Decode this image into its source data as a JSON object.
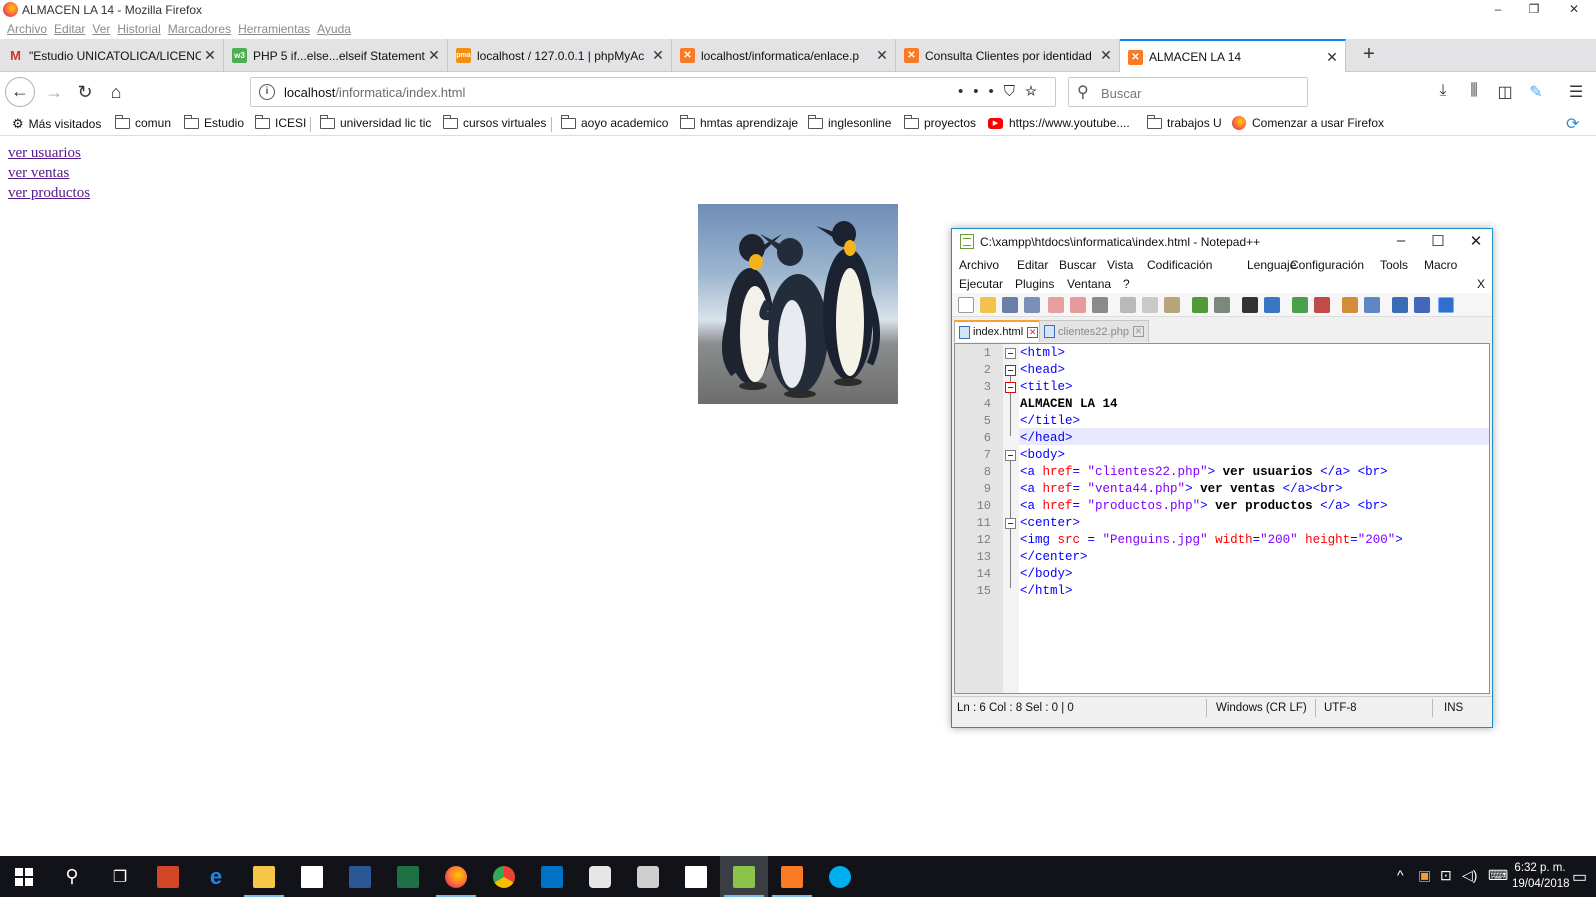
{
  "window": {
    "title": "ALMACEN LA 14 - Mozilla Firefox",
    "controls": [
      "–",
      "❐",
      "✕"
    ]
  },
  "menubar": [
    "Archivo",
    "Editar",
    "Ver",
    "Historial",
    "Marcadores",
    "Herramientas",
    "Ayuda"
  ],
  "tabs": [
    {
      "label": "\"Estudio UNICATOLICA/LICENC",
      "icon": "gmail-icon",
      "color": "#d93025"
    },
    {
      "label": "PHP 5 if...else...elseif Statement",
      "icon": "w3schools-icon",
      "color": "#4caf50"
    },
    {
      "label": "localhost / 127.0.0.1 | phpMyAc",
      "icon": "phpmyadmin-icon",
      "color": "#f29111"
    },
    {
      "label": "localhost/informatica/enlace.p",
      "icon": "xampp-icon",
      "color": "#fb7a24"
    },
    {
      "label": "Consulta Clientes por identidad",
      "icon": "xampp-icon",
      "color": "#fb7a24"
    },
    {
      "label": "ALMACEN LA 14",
      "icon": "xampp-icon",
      "color": "#fb7a24",
      "active": true
    }
  ],
  "newtab_label": "+",
  "nav": {
    "url_host": "localhost",
    "url_path": "/informatica/index.html",
    "search_placeholder": "Buscar"
  },
  "bookmarks": [
    {
      "label": "Más visitados",
      "icon": "gear-icon"
    },
    {
      "label": "comun",
      "icon": "folder-icon"
    },
    {
      "label": "Estudio",
      "icon": "folder-icon"
    },
    {
      "label": "ICESI",
      "icon": "folder-icon"
    },
    {
      "label": "universidad lic tic",
      "icon": "folder-icon"
    },
    {
      "label": "cursos virtuales",
      "icon": "folder-icon"
    },
    {
      "label": "aoyo academico",
      "icon": "folder-icon"
    },
    {
      "label": "hmtas aprendizaje",
      "icon": "folder-icon"
    },
    {
      "label": "inglesonline",
      "icon": "folder-icon"
    },
    {
      "label": "proyectos",
      "icon": "folder-icon"
    },
    {
      "label": "https://www.youtube....",
      "icon": "youtube-icon"
    },
    {
      "label": "trabajos U",
      "icon": "folder-icon"
    },
    {
      "label": "Comenzar a usar Firefox",
      "icon": "firefox-icon"
    }
  ],
  "page": {
    "links": [
      "ver usuarios",
      "ver ventas",
      "ver productos"
    ],
    "image_alt": "Penguins"
  },
  "notepad": {
    "title": "C:\\xampp\\htdocs\\informatica\\index.html - Notepad++",
    "menu_row1": [
      "Archivo",
      "Editar",
      "Buscar",
      "Vista",
      "Codificación",
      "Lenguaje",
      "Configuración",
      "Tools",
      "Macro"
    ],
    "menu_row2": [
      "Ejecutar",
      "Plugins",
      "Ventana",
      "?"
    ],
    "close_x": "X",
    "tabs": [
      {
        "label": "index.html",
        "active": true
      },
      {
        "label": "clientes22.php",
        "active": false
      }
    ],
    "line_numbers": [
      "1",
      "2",
      "3",
      "4",
      "5",
      "6",
      "7",
      "8",
      "9",
      "10",
      "11",
      "12",
      "13",
      "14",
      "15"
    ],
    "current_line": 6,
    "status": {
      "position": "Ln : 6    Col : 8    Sel : 0 | 0",
      "eol": "Windows (CR LF)",
      "encoding": "UTF-8",
      "mode": "INS"
    }
  },
  "taskbar": {
    "apps": [
      "start-icon",
      "search-icon",
      "task-view-icon",
      "powerpoint-icon",
      "edge-icon",
      "file-explorer-icon",
      "store-icon",
      "word-icon",
      "excel-icon",
      "firefox-icon",
      "chrome-icon",
      "outlook-icon",
      "app-icon",
      "app2-icon",
      "calculator-icon",
      "notepadpp-icon",
      "xampp-icon",
      "skype-icon"
    ],
    "time": "6:32 p. m.",
    "date": "19/04/2018"
  }
}
